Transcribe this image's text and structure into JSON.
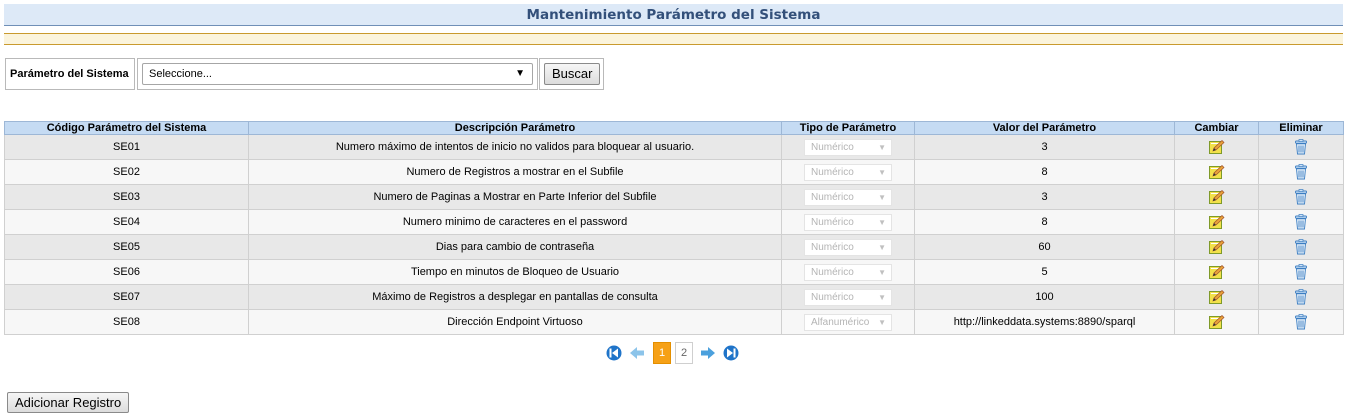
{
  "header": {
    "title": "Mantenimiento Parámetro del Sistema"
  },
  "filter": {
    "label": "Parámetro del Sistema",
    "select_value": "Seleccione...",
    "search_button": "Buscar"
  },
  "table": {
    "columns": [
      "Código Parámetro del Sistema",
      "Descripción Parámetro",
      "Tipo de Parámetro",
      "Valor del Parámetro",
      "Cambiar",
      "Eliminar"
    ],
    "rows": [
      {
        "code": "SE01",
        "description": "Numero máximo de intentos de inicio no validos para bloquear al usuario.",
        "type": "Numérico",
        "value": "3"
      },
      {
        "code": "SE02",
        "description": "Numero de Registros a mostrar en el Subfile",
        "type": "Numérico",
        "value": "8"
      },
      {
        "code": "SE03",
        "description": "Numero de Paginas a Mostrar en Parte Inferior del Subfile",
        "type": "Numérico",
        "value": "3"
      },
      {
        "code": "SE04",
        "description": "Numero minimo de caracteres en el password",
        "type": "Numérico",
        "value": "8"
      },
      {
        "code": "SE05",
        "description": "Dias para cambio de contraseña",
        "type": "Numérico",
        "value": "60"
      },
      {
        "code": "SE06",
        "description": "Tiempo en minutos de Bloqueo de Usuario",
        "type": "Numérico",
        "value": "5"
      },
      {
        "code": "SE07",
        "description": "Máximo de Registros a desplegar en pantallas de consulta",
        "type": "Numérico",
        "value": "100"
      },
      {
        "code": "SE08",
        "description": "Dirección Endpoint Virtuoso",
        "type": "Alfanumérico",
        "value": "http://linkeddata.systems:8890/sparql"
      }
    ]
  },
  "pagination": {
    "pages": [
      "1",
      "2"
    ],
    "current_page": "1"
  },
  "actions": {
    "add_button": "Adicionar Registro"
  },
  "colors": {
    "accent": "#33507a",
    "header_bg": "#c5dbf3",
    "active_page": "#f6a117"
  },
  "icons": {
    "edit": "edit-pencil-icon",
    "delete": "trash-icon",
    "first": "first-page-icon",
    "prev": "prev-page-icon",
    "next": "next-page-icon",
    "last": "last-page-icon"
  }
}
